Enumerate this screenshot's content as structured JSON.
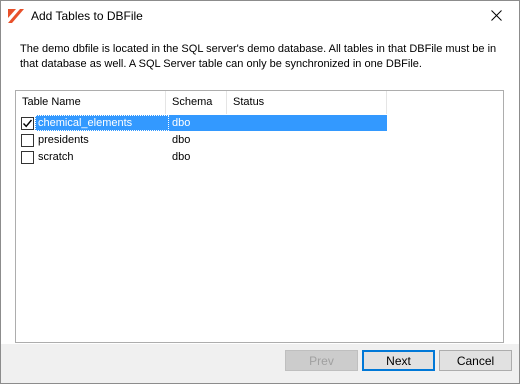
{
  "window": {
    "title": "Add Tables to DBFile"
  },
  "description": "The demo dbfile is located in the SQL server's demo database. All tables in that DBFile must be in that database as well. A SQL Server table can only be synchronized in one DBFile.",
  "grid": {
    "columns": [
      "Table Name",
      "Schema",
      "Status"
    ],
    "rows": [
      {
        "checked": true,
        "name": "chemical_elements",
        "schema": "dbo",
        "status": "",
        "selected": true
      },
      {
        "checked": false,
        "name": "presidents",
        "schema": "dbo",
        "status": "",
        "selected": false
      },
      {
        "checked": false,
        "name": "scratch",
        "schema": "dbo",
        "status": "",
        "selected": false
      }
    ]
  },
  "buttons": {
    "prev": "Prev",
    "next": "Next",
    "cancel": "Cancel"
  },
  "colors": {
    "selection": "#3399ff",
    "app_icon": "#e8502a",
    "default_button_border": "#0078d7"
  },
  "icons": {
    "app": "app-logo-icon",
    "close": "close-icon",
    "check": "check-icon"
  }
}
